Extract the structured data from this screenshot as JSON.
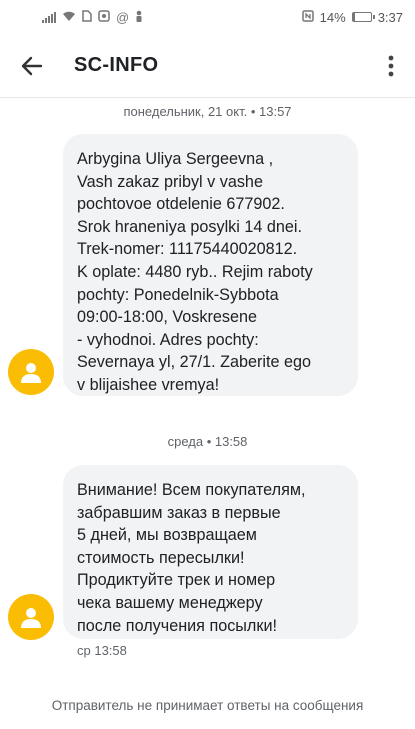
{
  "status_bar": {
    "battery_percent_label": "14%",
    "battery_level": 0.14,
    "time": "3:37"
  },
  "app_bar": {
    "title": "SC-INFO",
    "icons": [
      "back-arrow-icon",
      "more-vert-icon"
    ]
  },
  "messages": [
    {
      "date_separator": "понедельник, 21 окт. • 13:57",
      "text": "Arbygina Uliya Sergeevna ,\nVash zakaz pribyl v vashe\npochtovoe otdelenie 677902.\nSrok hraneniya posylki 14 dnei.\nTrek-nomer: 11175440020812.\nK oplate: 4480 ryb.. Rejim raboty\npochty: Ponedelnik-Sybbota\n09:00-18:00, Voskresene\n- vyhodnoi. Adres pochty:\nSevernaya yl, 27/1. Zaberite ego\nv blijaishee vremya!",
      "timestamp": ""
    },
    {
      "date_separator": "среда • 13:58",
      "text": "Внимание! Всем покупателям,\nзабравшим заказ в первые\n5 дней, мы возвращаем\nстоимость пересылки!\nПродиктуйте трек и номер\nчека вашему менеджеру\nпосле получения посылки!",
      "timestamp": "ср 13:58"
    }
  ],
  "footer_notice": "Отправитель не принимает ответы на сообщения",
  "colors": {
    "bubble_bg": "#f1f3f4",
    "avatar": "#fbbc04",
    "secondary_text": "#5f6368"
  }
}
